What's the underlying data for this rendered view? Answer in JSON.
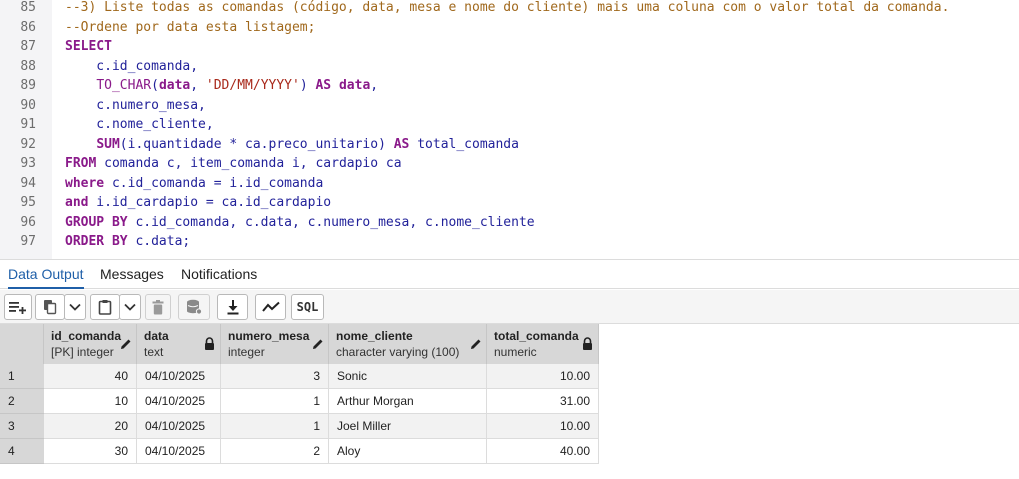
{
  "editor": {
    "lines": [
      {
        "n": "85",
        "tokens": [
          {
            "t": "--3) Liste todas as comandas (código, data, mesa e nome do cliente) mais uma coluna com o valor total da comanda.",
            "c": "comment"
          }
        ]
      },
      {
        "n": "86",
        "tokens": [
          {
            "t": "--Ordene por data esta listagem;",
            "c": "comment"
          }
        ]
      },
      {
        "n": "87",
        "tokens": [
          {
            "t": "SELECT",
            "c": "kw"
          }
        ]
      },
      {
        "n": "88",
        "tokens": [
          {
            "t": "    c.id_comanda,",
            "c": "plain"
          }
        ]
      },
      {
        "n": "89",
        "tokens": [
          {
            "t": "    ",
            "c": "plain"
          },
          {
            "t": "TO_CHAR",
            "c": "fn"
          },
          {
            "t": "(",
            "c": "plain"
          },
          {
            "t": "data",
            "c": "kw"
          },
          {
            "t": ", ",
            "c": "plain"
          },
          {
            "t": "'DD/MM/YYYY'",
            "c": "str"
          },
          {
            "t": ") ",
            "c": "plain"
          },
          {
            "t": "AS",
            "c": "kw"
          },
          {
            "t": " ",
            "c": "plain"
          },
          {
            "t": "data",
            "c": "kw"
          },
          {
            "t": ",",
            "c": "plain"
          }
        ]
      },
      {
        "n": "90",
        "tokens": [
          {
            "t": "    c.numero_mesa,",
            "c": "plain"
          }
        ]
      },
      {
        "n": "91",
        "tokens": [
          {
            "t": "    c.nome_cliente,",
            "c": "plain"
          }
        ]
      },
      {
        "n": "92",
        "tokens": [
          {
            "t": "    ",
            "c": "plain"
          },
          {
            "t": "SUM",
            "c": "kw"
          },
          {
            "t": "(i.quantidade * ca.preco_unitario) ",
            "c": "plain"
          },
          {
            "t": "AS",
            "c": "kw"
          },
          {
            "t": " total_comanda",
            "c": "plain"
          }
        ]
      },
      {
        "n": "93",
        "tokens": [
          {
            "t": "FROM",
            "c": "kw"
          },
          {
            "t": " comanda c, item_comanda i, cardapio ca",
            "c": "plain"
          }
        ]
      },
      {
        "n": "94",
        "tokens": [
          {
            "t": "where",
            "c": "kw"
          },
          {
            "t": " c.id_comanda = i.id_comanda",
            "c": "plain"
          }
        ]
      },
      {
        "n": "95",
        "tokens": [
          {
            "t": "and",
            "c": "kw"
          },
          {
            "t": " i.id_cardapio = ca.id_cardapio",
            "c": "plain"
          }
        ]
      },
      {
        "n": "96",
        "tokens": [
          {
            "t": "GROUP BY",
            "c": "kw"
          },
          {
            "t": " c.id_comanda, c.data, c.numero_mesa, c.nome_cliente",
            "c": "plain"
          }
        ]
      },
      {
        "n": "97",
        "tokens": [
          {
            "t": "ORDER BY",
            "c": "kw"
          },
          {
            "t": " c.data;",
            "c": "plain"
          }
        ]
      }
    ]
  },
  "tabs": {
    "data_output": "Data Output",
    "messages": "Messages",
    "notifications": "Notifications"
  },
  "toolbar": {
    "sql_label": "SQL",
    "icons": [
      "add-row-icon",
      "copy-icon",
      "chevron-down-icon",
      "paste-icon",
      "chevron-down-icon",
      "delete-icon",
      "save-data-icon",
      "download-icon",
      "graph-icon",
      "sql-icon"
    ]
  },
  "grid": {
    "columns": [
      {
        "name": "id_comanda",
        "type": "[PK] integer",
        "icon": "pencil-icon"
      },
      {
        "name": "data",
        "type": "text",
        "icon": "lock-icon"
      },
      {
        "name": "numero_mesa",
        "type": "integer",
        "icon": "pencil-icon"
      },
      {
        "name": "nome_cliente",
        "type": "character varying (100)",
        "icon": "pencil-icon"
      },
      {
        "name": "total_comanda",
        "type": "numeric",
        "icon": "lock-icon"
      }
    ],
    "rows": [
      {
        "n": "1",
        "cells": [
          "40",
          "04/10/2025",
          "3",
          "Sonic",
          "10.00"
        ]
      },
      {
        "n": "2",
        "cells": [
          "10",
          "04/10/2025",
          "1",
          "Arthur Morgan",
          "31.00"
        ]
      },
      {
        "n": "3",
        "cells": [
          "20",
          "04/10/2025",
          "1",
          "Joel Miller",
          "10.00"
        ]
      },
      {
        "n": "4",
        "cells": [
          "30",
          "04/10/2025",
          "2",
          "Aloy",
          "40.00"
        ]
      }
    ]
  },
  "colors": {
    "comment": "#a0681c",
    "keyword": "#8a1a8a",
    "string": "#a8281a",
    "identifier": "#22229a",
    "active_tab": "#1f5fa8",
    "header_bg": "#d7d7d7"
  }
}
